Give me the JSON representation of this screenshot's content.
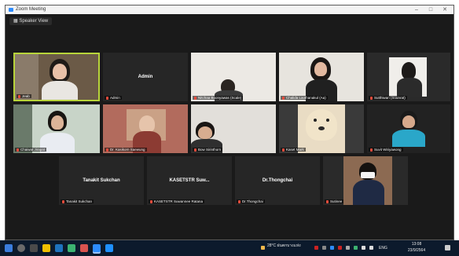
{
  "window": {
    "title": "Zoom Meeting",
    "view_label": "Speaker View"
  },
  "participants": [
    {
      "tile": "p1",
      "label": "Jeab",
      "center": "",
      "video": true,
      "active": true
    },
    {
      "tile": "p2",
      "label": "Admin",
      "center": "Admin",
      "video": false
    },
    {
      "tile": "p3",
      "label": "Nitchaa Boonyawas (Scale)",
      "center": "",
      "video": true
    },
    {
      "tile": "p4",
      "label": "Chalida Laothanakul (Aa)",
      "center": "",
      "video": true
    },
    {
      "tile": "p5",
      "label": "Sutthiwan (Srainrat)",
      "center": "",
      "video": true
    },
    {
      "tile": "p6",
      "label": "Chaiwat Jirapat",
      "center": "",
      "video": true
    },
    {
      "tile": "p7",
      "label": "Dr. Kasikorn Saewung",
      "center": "",
      "video": true
    },
    {
      "tile": "p8",
      "label": "Bow Sirinthorn",
      "center": "",
      "video": true
    },
    {
      "tile": "p9",
      "label": "Kaset Mark",
      "center": "",
      "video": true
    },
    {
      "tile": "p10",
      "label": "Suvit Wiriyawong",
      "center": "",
      "video": true
    },
    {
      "tile": "p11",
      "label": "Tanakit Sukchan",
      "center": "Tanakit Sukchan",
      "video": false
    },
    {
      "tile": "p12",
      "label": "KASETSTR Suwannee Ratana",
      "center": "KASETSTR Suw...",
      "video": false
    },
    {
      "tile": "p13",
      "label": "Dr.Thongchai",
      "center": "Dr.Thongchai",
      "video": false
    },
    {
      "tile": "p14",
      "label": "Sutinee",
      "center": "",
      "video": true
    }
  ],
  "taskbar": {
    "tray_text": "28°C  ฝนตกบางแห่ง",
    "lang": "ENG",
    "time": "13:08",
    "date": "23/9/2564"
  },
  "colors": {
    "accent_active": "#b8d43a",
    "tile_bg": "#262626",
    "window_bg": "#1a1a1a",
    "taskbar_bg": "#0c1a2c"
  }
}
